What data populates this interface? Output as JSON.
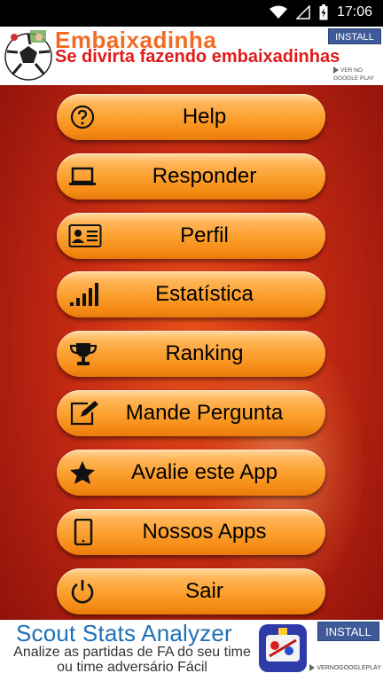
{
  "status_bar": {
    "time": "17:06"
  },
  "top_ad": {
    "title": "Embaixadinha",
    "subtitle": "Se divirta fazendo embaixadinhas",
    "install_label": "INSTALL",
    "store_line1": "VER NO",
    "store_line2": "GOOGLE PLAY"
  },
  "menu": {
    "items": [
      {
        "label": "Help",
        "icon": "question-circle-icon"
      },
      {
        "label": "Responder",
        "icon": "laptop-icon"
      },
      {
        "label": "Perfil",
        "icon": "id-card-icon"
      },
      {
        "label": "Estatística",
        "icon": "signal-bars-icon"
      },
      {
        "label": "Ranking",
        "icon": "trophy-icon"
      },
      {
        "label": "Mande Pergunta",
        "icon": "edit-icon"
      },
      {
        "label": "Avalie este App",
        "icon": "star-icon"
      },
      {
        "label": "Nossos Apps",
        "icon": "tablet-icon"
      },
      {
        "label": "Sair",
        "icon": "power-icon"
      }
    ]
  },
  "bottom_ad": {
    "title": "Scout Stats Analyzer",
    "description": "Analize as partidas de FA do seu time ou time adversário Fácil",
    "install_label": "INSTALL",
    "store_label": "VERNOGOOGLEPLAY"
  },
  "colors": {
    "button_orange": "#fb9e2c",
    "background_red": "#c42a12",
    "ad_title_orange": "#f26b22",
    "ad_subtitle_red": "#e01b1b",
    "install_blue": "#3e5a98",
    "bottom_title_blue": "#1e6fb8"
  }
}
